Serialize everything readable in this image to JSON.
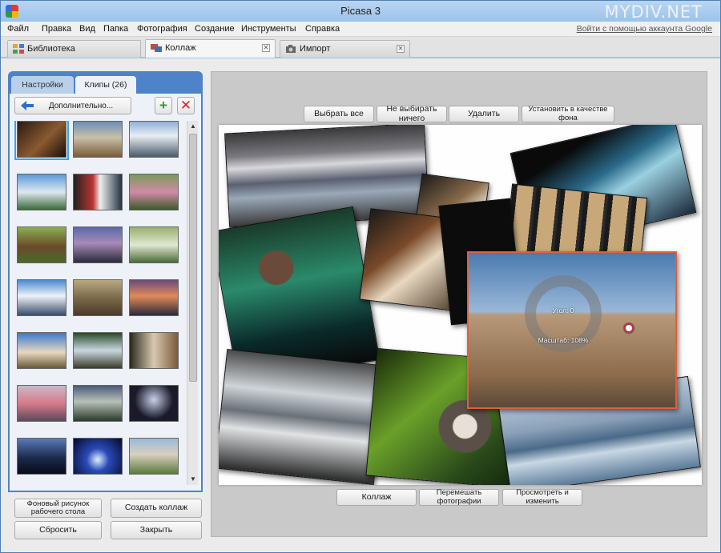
{
  "window": {
    "title": "Picasa 3",
    "watermark": "MYDIV.NET"
  },
  "menu": {
    "items": [
      "Файл",
      "Правка",
      "Вид",
      "Папка",
      "Фотография",
      "Создание",
      "Инструменты",
      "Справка"
    ],
    "signin": "Войти с помощью аккаунта Google"
  },
  "tabs": [
    {
      "label": "Библиотека",
      "active": false
    },
    {
      "label": "Коллаж",
      "active": true
    },
    {
      "label": "Импорт",
      "active": false
    }
  ],
  "panel": {
    "tab_settings": "Настройки",
    "tab_clips": "Клипы (26)",
    "more_button": "Дополнительно...",
    "add_symbol": "+",
    "remove_symbol": "✕"
  },
  "bottom_left_buttons": {
    "wallpaper": "Фоновый рисунок рабочего стола",
    "create_collage": "Создать коллаж",
    "reset": "Сбросить",
    "close": "Закрыть"
  },
  "toolbar": {
    "select_all": "Выбрать все",
    "select_none": "Не выбирать ничего",
    "delete": "Удалить",
    "set_background": "Установить в качестве фона"
  },
  "bottom_buttons": {
    "collage": "Коллаж",
    "shuffle": "Перемешать фотографии",
    "preview_edit": "Просмотреть и изменить"
  },
  "overlay": {
    "angle_label": "Угол: 0",
    "scale_label": "Масштаб: 108%"
  },
  "colors": {
    "window_frame": "#9cc3ea",
    "panel_blue": "#4e82c9",
    "selection": "#e0603a"
  }
}
